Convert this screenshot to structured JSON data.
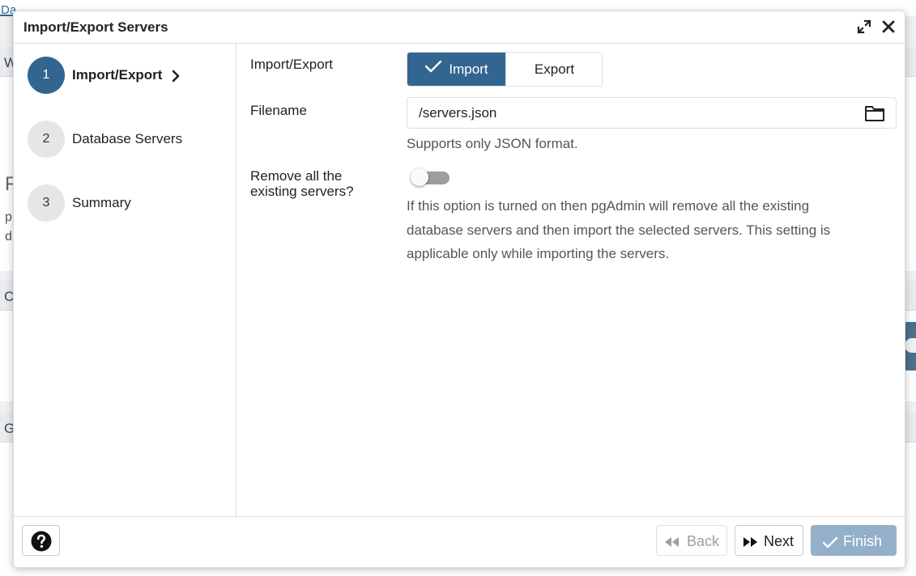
{
  "background": {
    "tab_fragment": "Da",
    "letters": [
      "W",
      "F",
      "p",
      "d",
      "C",
      "G"
    ]
  },
  "dialog": {
    "title": "Import/Export Servers",
    "header_icons": [
      "expand-icon",
      "close-icon"
    ]
  },
  "steps": [
    {
      "number": "1",
      "label": "Import/Export",
      "active": true
    },
    {
      "number": "2",
      "label": "Database Servers",
      "active": false
    },
    {
      "number": "3",
      "label": "Summary",
      "active": false
    }
  ],
  "form": {
    "mode_label": "Import/Export",
    "mode_options": {
      "import": "Import",
      "export": "Export"
    },
    "mode_selected": "Import",
    "filename_label": "Filename",
    "filename_value": "/servers.json",
    "filename_help": "Supports only JSON format.",
    "remove_label_line1": "Remove all the",
    "remove_label_line2": "existing servers?",
    "remove_value": false,
    "remove_help_line1": "If this option is turned on then pgAdmin will remove all the existing",
    "remove_help_line2": "database servers and then import the selected servers. This setting is",
    "remove_help_line3": "applicable only while importing the servers."
  },
  "footer": {
    "back_label": "Back",
    "next_label": "Next",
    "finish_label": "Finish"
  },
  "colors": {
    "primary": "#326690",
    "primary_disabled": "#93b0c8",
    "step_inactive": "#e6e6e6"
  }
}
